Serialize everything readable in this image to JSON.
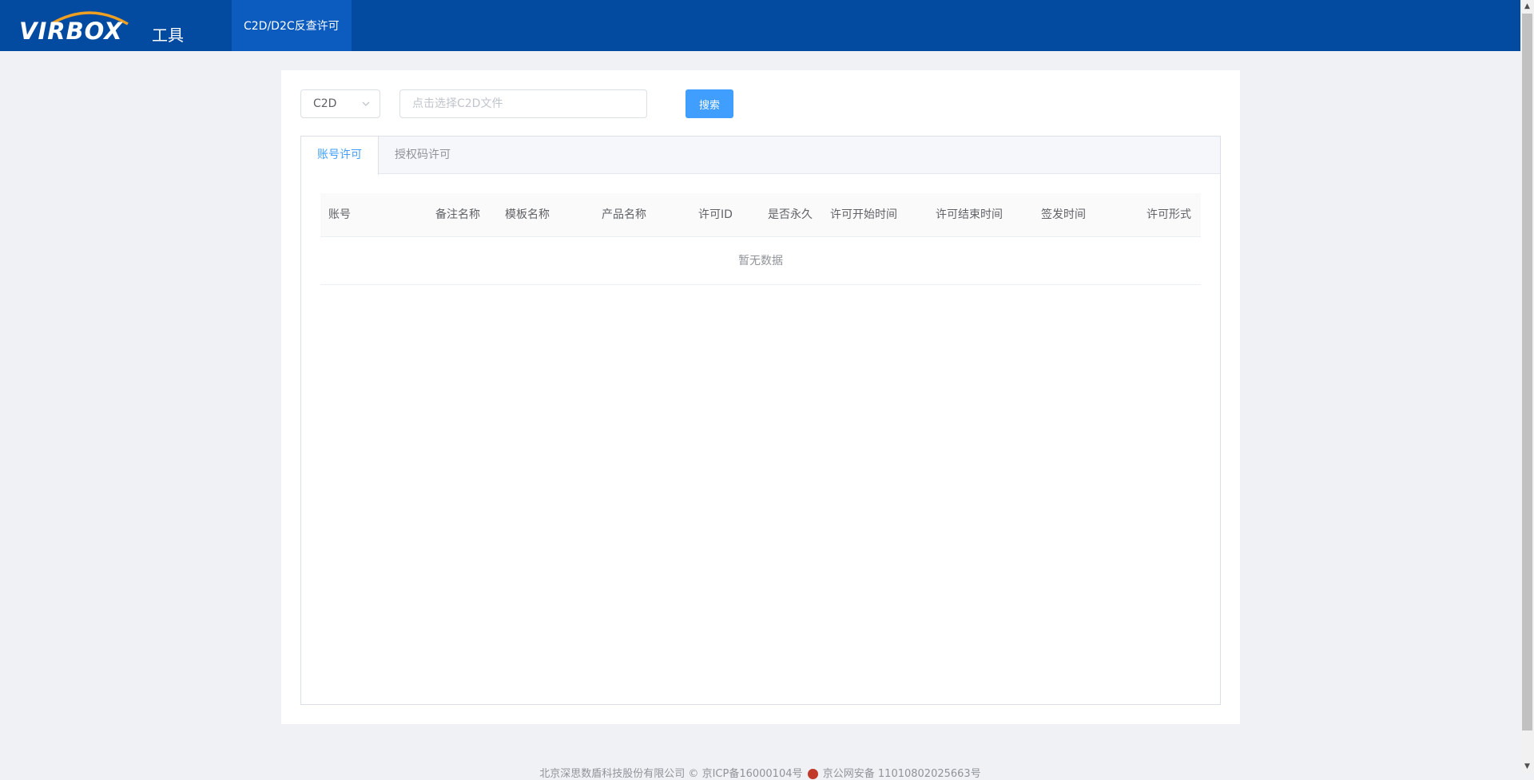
{
  "header": {
    "logo_text": "VIRBOX",
    "logo_suffix": "工具",
    "nav": [
      {
        "label": "C2D/D2C反查许可"
      }
    ]
  },
  "search": {
    "type_selected": "C2D",
    "file_placeholder": "点击选择C2D文件",
    "search_button": "搜索"
  },
  "tabs": [
    {
      "label": "账号许可",
      "active": true
    },
    {
      "label": "授权码许可",
      "active": false
    }
  ],
  "table": {
    "columns": [
      "账号",
      "备注名称",
      "模板名称",
      "产品名称",
      "许可ID",
      "是否永久",
      "许可开始时间",
      "许可结束时间",
      "签发时间",
      "许可形式"
    ],
    "empty_text": "暂无数据"
  },
  "footer": {
    "company": "北京深思数盾科技股份有限公司 ©",
    "icp": "京ICP备16000104号",
    "police": "京公网安备 11010802025663号"
  },
  "colors": {
    "header_bg": "#034ba1",
    "nav_active_bg": "#0c5bbf",
    "accent": "#409eff"
  }
}
